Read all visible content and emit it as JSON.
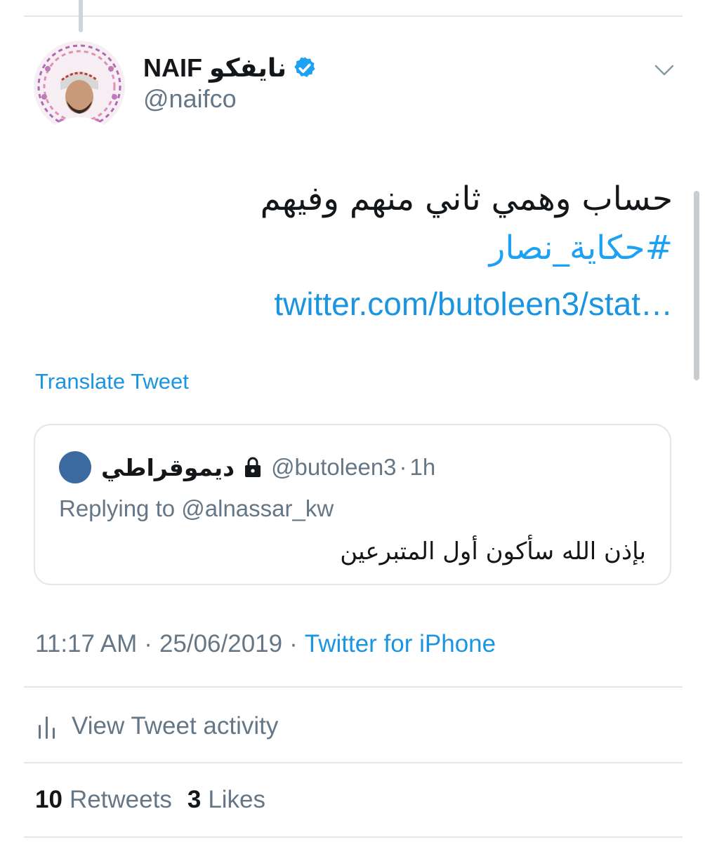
{
  "tweet": {
    "author": {
      "display_name": "NAIF نايفكو",
      "handle": "@naifco",
      "verified": true,
      "avatar_icon": "profile-photo"
    },
    "text": "حساب وهمي ثاني منهم وفيهم",
    "hashtag": "#حكاية_نصار",
    "link": "twitter.com/butoleen3/stat…",
    "translate_label": "Translate Tweet",
    "menu_icon": "chevron-down-icon"
  },
  "quoted_tweet": {
    "display_name": "ديموقراطي",
    "protected": true,
    "handle": "@butoleen3",
    "separator": "·",
    "time": "1h",
    "replying_to": "Replying to @alnassar_kw",
    "text": "بإذن الله سأكون أول المتبرعين",
    "avatar_color": "#3b6aa0"
  },
  "meta": {
    "time": "11:17 AM",
    "separator": "·",
    "date": "25/06/2019",
    "source": "Twitter for iPhone"
  },
  "activity": {
    "label": "View Tweet activity",
    "icon": "bar-chart-icon"
  },
  "stats": {
    "retweets_count": "10",
    "retweets_label": "Retweets",
    "likes_count": "3",
    "likes_label": "Likes"
  },
  "colors": {
    "link": "#1b95e0",
    "hashtag": "#1da1f2",
    "secondary_text": "#657786",
    "divider": "#e1e8ed"
  }
}
